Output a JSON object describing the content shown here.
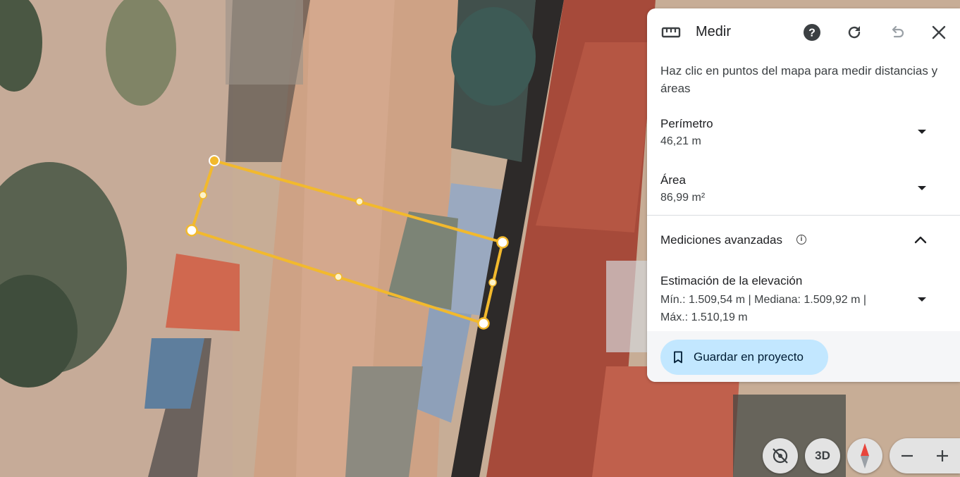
{
  "panel": {
    "title": "Medir",
    "hint": "Haz clic en puntos del mapa para medir distancias y áreas",
    "perimeter": {
      "label": "Perímetro",
      "value": "46,21 m"
    },
    "area": {
      "label": "Área",
      "value": "86,99 m²"
    },
    "advanced": {
      "label": "Mediciones avanzadas",
      "info_icon": "ⓘ"
    },
    "elevation": {
      "label": "Estimación de la elevación",
      "value": "Mín.: 1.509,54 m | Mediana: 1.509,92 m | Máx.: 1.510,19 m"
    },
    "save_label": "Guardar en proyecto",
    "icons": [
      "ruler-icon",
      "help-icon",
      "refresh-icon",
      "undo-icon",
      "close-icon",
      "bookmark-icon"
    ]
  },
  "controls": {
    "three_d_label": "3D",
    "icons": [
      "tilt-off-icon",
      "compass-icon",
      "zoom-out-icon",
      "zoom-in-icon"
    ]
  },
  "colors": {
    "measure_line": "#f2b92d",
    "save_button": "#c2e7ff",
    "compass_red": "#e8453c"
  }
}
